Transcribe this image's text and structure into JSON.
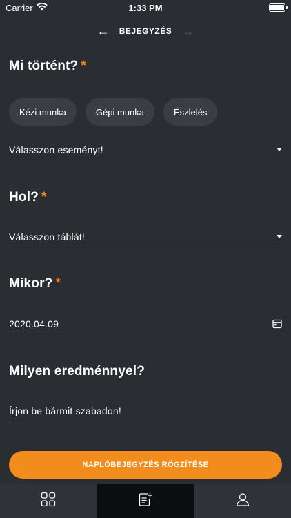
{
  "status_bar": {
    "carrier": "Carrier",
    "time": "1:33 PM"
  },
  "header": {
    "title": "BEJEGYZÉS",
    "back_icon": "arrow-left-icon",
    "forward_icon": "arrow-right-icon"
  },
  "what": {
    "title": "Mi történt?",
    "required_mark": "*",
    "chips": [
      "Kézi munka",
      "Gépi munka",
      "Észlelés"
    ],
    "event_select": "Válasszon eseményt!"
  },
  "where": {
    "title": "Hol?",
    "required_mark": "*",
    "table_select": "Válasszon táblát!"
  },
  "when": {
    "title": "Mikor?",
    "required_mark": "*",
    "date_value": "2020.04.09"
  },
  "result": {
    "title": "Milyen eredménnyel?",
    "placeholder": "Írjon be bármit szabadon!"
  },
  "submit": {
    "label": "NAPLÓBEJEGYZÉS RÖGZÍTÉSE"
  },
  "colors": {
    "accent": "#f28c1c",
    "background": "#2a2d31",
    "chip": "#3a3e44"
  },
  "tabs": [
    {
      "icon": "grid-icon",
      "active": false
    },
    {
      "icon": "edit-note-icon",
      "active": true
    },
    {
      "icon": "user-icon",
      "active": false
    }
  ]
}
